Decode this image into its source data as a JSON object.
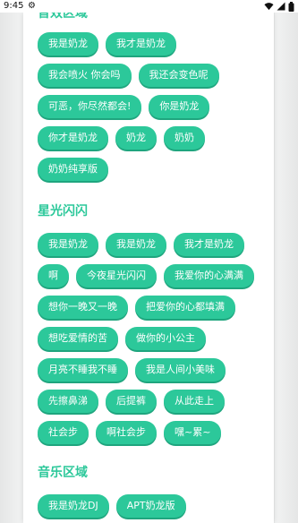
{
  "status_bar": {
    "time": "9:45"
  },
  "sections": [
    {
      "title": "音效区域",
      "items": [
        "我是奶龙",
        "我才是奶龙",
        "我会喷火 你会吗",
        "我还会变色呢",
        "可恶，你尽然都会!",
        "你是奶龙",
        "你才是奶龙",
        "奶龙",
        "奶奶",
        "奶奶纯享版"
      ]
    },
    {
      "title": "星光闪闪",
      "items": [
        "我是奶龙",
        "我是奶龙",
        "我才是奶龙",
        "啊",
        "今夜星光闪闪",
        "我爱你的心满满",
        "想你一晚又一晚",
        "把爱你的心都填满",
        "想吃爱情的苦",
        "做你的小公主",
        "月亮不睡我不睡",
        "我是人间小美味",
        "先擦鼻涕",
        "后提裤",
        "从此走上",
        "社会步",
        "啊社会步",
        "嘿~累~"
      ]
    },
    {
      "title": "音乐区域",
      "items": [
        "我是奶龙DJ",
        "APT奶龙版"
      ]
    }
  ]
}
